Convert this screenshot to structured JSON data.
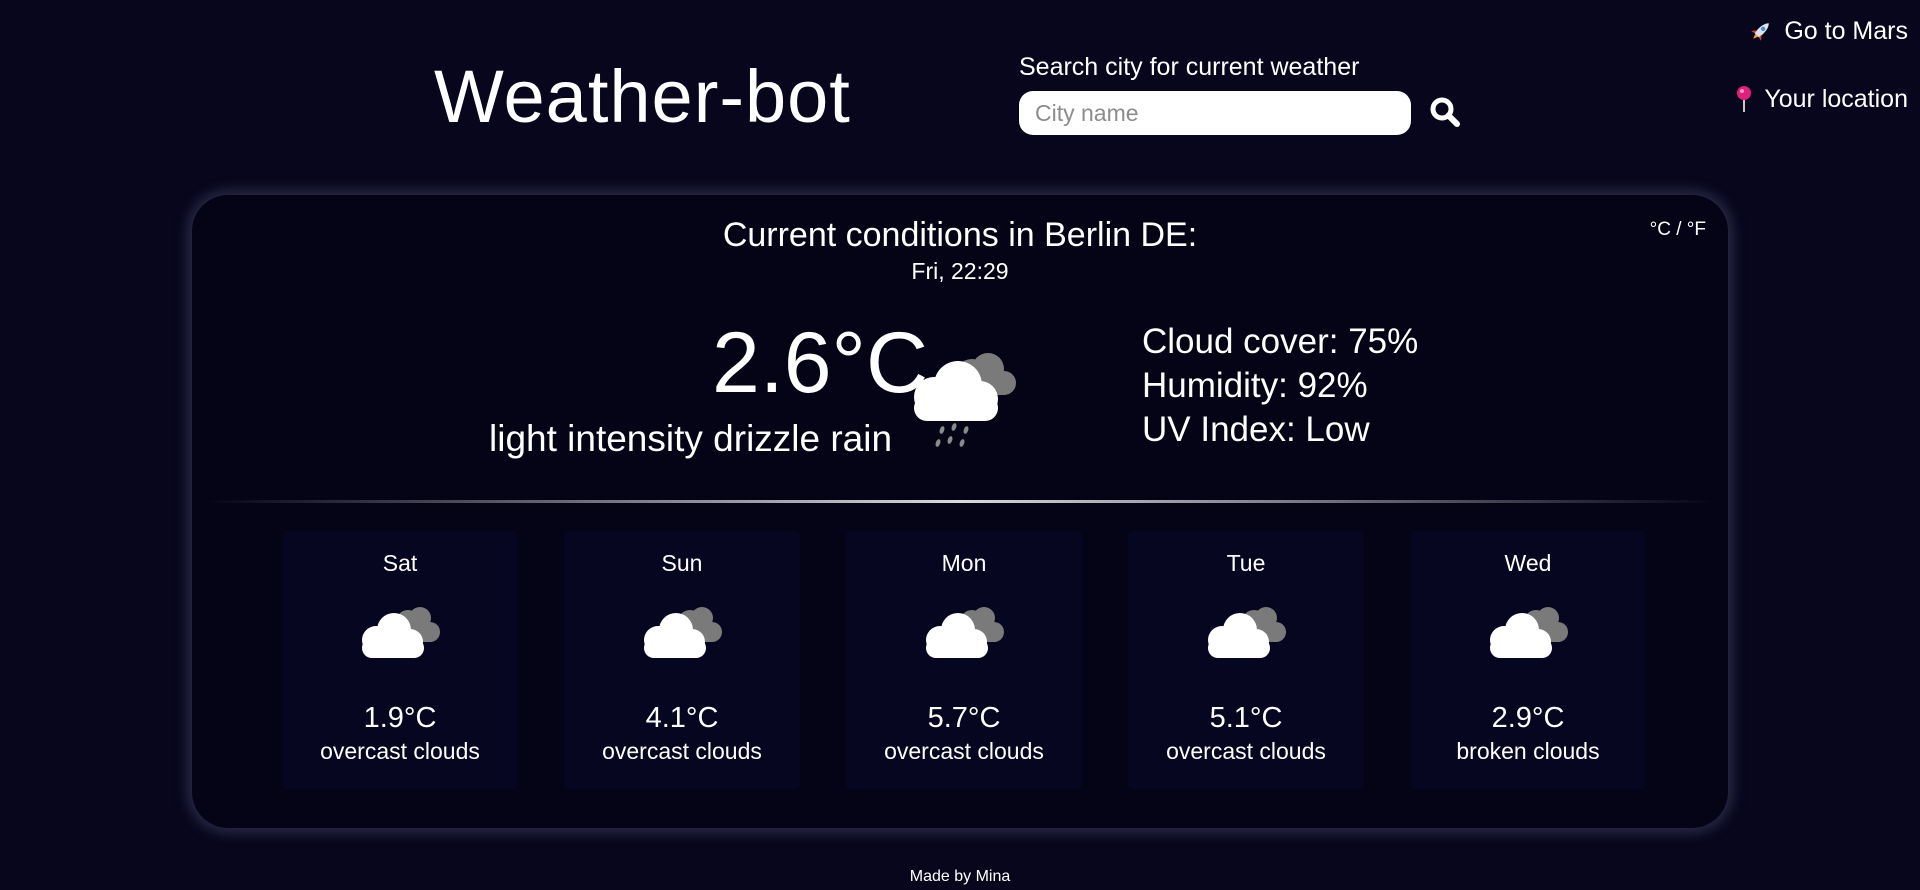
{
  "header": {
    "title": "Weather-bot",
    "search_label": "Search city for current weather",
    "search_placeholder": "City name",
    "search_value": "",
    "search_icon": "search-icon"
  },
  "nav": {
    "mars": {
      "label": "Go to Mars",
      "icon": "rocket-icon"
    },
    "location": {
      "label": "Your location",
      "icon": "pushpin-icon"
    }
  },
  "current": {
    "unit_toggle": "°C / °F",
    "heading": "Current conditions in Berlin DE:",
    "time": "Fri, 22:29",
    "temperature": "2.6°C",
    "description": "light intensity drizzle rain",
    "icon": "drizzle-cloud-icon",
    "cloud_cover": "Cloud cover: 75%",
    "humidity": "Humidity: 92%",
    "uv_index": "UV Index: Low"
  },
  "forecast": [
    {
      "day": "Sat",
      "temp": "1.9°C",
      "desc": "overcast clouds",
      "icon": "overcast-clouds-icon"
    },
    {
      "day": "Sun",
      "temp": "4.1°C",
      "desc": "overcast clouds",
      "icon": "overcast-clouds-icon"
    },
    {
      "day": "Mon",
      "temp": "5.7°C",
      "desc": "overcast clouds",
      "icon": "overcast-clouds-icon"
    },
    {
      "day": "Tue",
      "temp": "5.1°C",
      "desc": "overcast clouds",
      "icon": "overcast-clouds-icon"
    },
    {
      "day": "Wed",
      "temp": "2.9°C",
      "desc": "broken clouds",
      "icon": "broken-clouds-icon"
    }
  ],
  "footer": {
    "text": "Made by Mina"
  },
  "colors": {
    "background": "#07061d",
    "card": "#050416",
    "text": "#ffffff",
    "pin": "#e0217a"
  }
}
